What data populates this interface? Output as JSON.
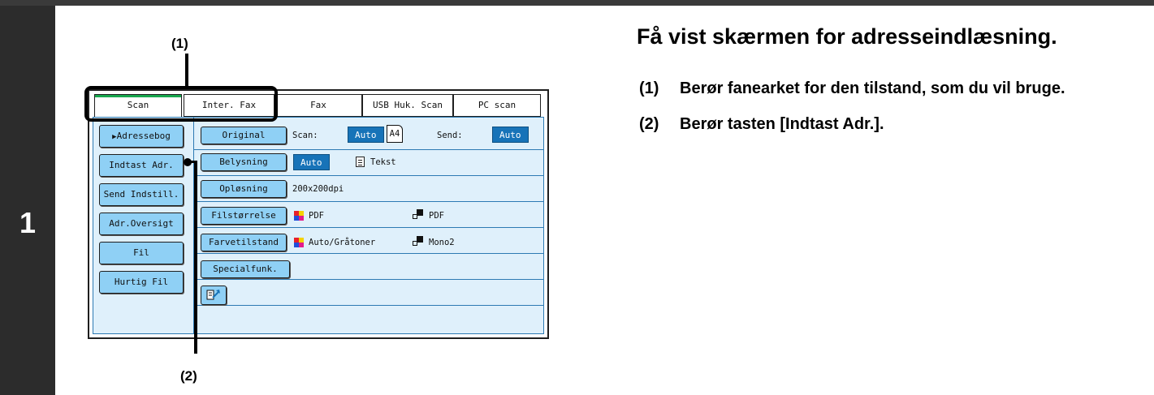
{
  "step_number": "1",
  "callouts": {
    "one": "(1)",
    "two": "(2)"
  },
  "tabs": [
    {
      "label": "Scan",
      "active": true
    },
    {
      "label": "Inter. Fax",
      "active": false
    },
    {
      "label": "Fax",
      "active": false
    },
    {
      "label": "USB Huk. Scan",
      "active": false
    },
    {
      "label": "PC scan",
      "active": false
    }
  ],
  "sidebar": [
    {
      "label": "Adressebog"
    },
    {
      "label": "Indtast Adr."
    },
    {
      "label": "Send Indstill."
    },
    {
      "label": "Adr.Oversigt"
    },
    {
      "label": "Fil"
    },
    {
      "label": "Hurtig Fil"
    }
  ],
  "rows": {
    "original": {
      "button": "Original",
      "scan_label": "Scan:",
      "scan_value": "Auto",
      "paper": "A4",
      "send_label": "Send:",
      "send_value": "Auto"
    },
    "belysning": {
      "button": "Belysning",
      "value": "Auto",
      "mode": "Tekst"
    },
    "oplosning": {
      "button": "Opløsning",
      "value": "200x200dpi"
    },
    "filstorrelse": {
      "button": "Filstørrelse",
      "color_value": "PDF",
      "mono_value": "PDF"
    },
    "farvetilstand": {
      "button": "Farvetilstand",
      "color_value": "Auto/Gråtoner",
      "mono_value": "Mono2"
    },
    "specialfunk": {
      "button": "Specialfunk."
    }
  },
  "icons": {
    "active_sidebar": "play-arrow-icon",
    "preview": "preview-icon",
    "text_mode": "document-text-icon"
  },
  "colors": {
    "accent_blue": "#1773b8",
    "button_blue": "#8fd0f5",
    "panel_bg": "#dff0fb",
    "active_tab": "#18a84f"
  },
  "instructions": {
    "heading": "Få vist skærmen for adresseindlæsning.",
    "steps": [
      {
        "number": "(1)",
        "text": "Berør fanearket for den tilstand, som du vil bruge."
      },
      {
        "number": "(2)",
        "text": "Berør tasten [Indtast Adr.]."
      }
    ]
  }
}
